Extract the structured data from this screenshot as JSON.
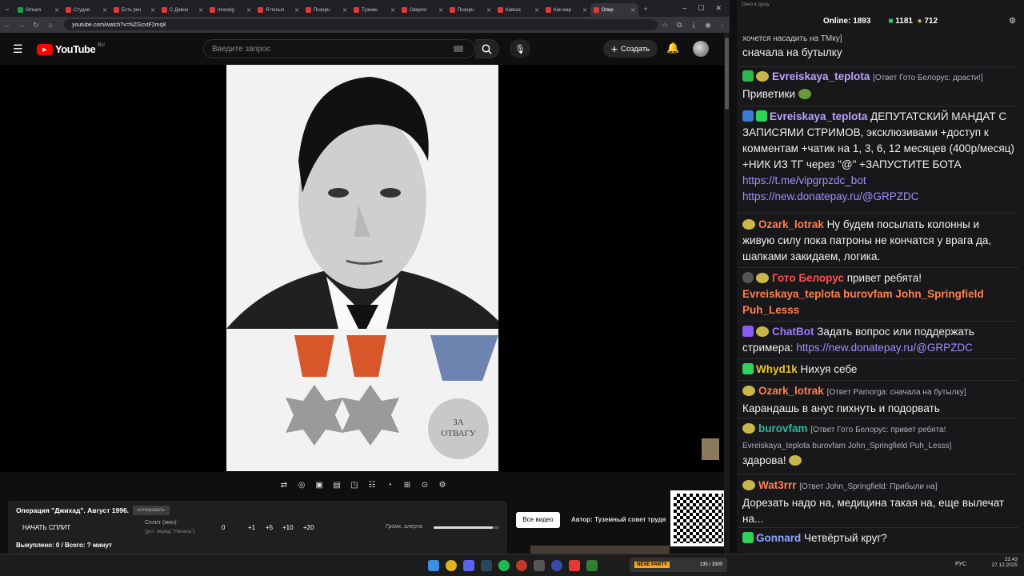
{
  "tabs": [
    {
      "label": "Stream",
      "color": "#1aa14a",
      "active": false
    },
    {
      "label": "Студия",
      "color": "#e53935",
      "active": false
    },
    {
      "label": "Есть реч",
      "color": "#e53935",
      "active": false
    },
    {
      "label": "С Девон",
      "color": "#e53935",
      "active": false
    },
    {
      "label": "Investig",
      "color": "#e53935",
      "active": false
    },
    {
      "label": "Я посыл",
      "color": "#e53935",
      "active": false
    },
    {
      "label": "Позорн",
      "color": "#e53935",
      "active": false
    },
    {
      "label": "Туземн",
      "color": "#e53935",
      "active": false
    },
    {
      "label": "Оверло",
      "color": "#e53935",
      "active": false
    },
    {
      "label": "Позорн",
      "color": "#e53935",
      "active": false
    },
    {
      "label": "Кавказ",
      "color": "#e53935",
      "active": false
    },
    {
      "label": "Как мар",
      "color": "#e53935",
      "active": false
    },
    {
      "label": "Опер",
      "color": "#e53935",
      "active": true
    }
  ],
  "browser": {
    "url": "youtube.com/watch?v=NZGcvtF2mq8"
  },
  "youtube": {
    "logo": "YouTube",
    "region": "RU",
    "search_placeholder": "Введите запрос",
    "create_label": "Создать"
  },
  "panel": {
    "title": "Операция \"Джихад\". Август 1996.",
    "copy_label": "копировать",
    "start_split": "НАЧАТЬ СПЛИТ",
    "split_label": "Сплит (мин):",
    "split_hint": "(уст. перед \"Начать\")",
    "split_value": "0",
    "steps": [
      "+1",
      "+5",
      "+10",
      "+20"
    ],
    "volume_label": "Громк. алерта:",
    "volume_level": 0.9,
    "paid": "Выкуплено: 0 / Всего: ? минут"
  },
  "overlay": {
    "all_video": "Все видео",
    "author": "Автор: Туземный совет трудя"
  },
  "chat_window_title": "Окно в душу",
  "chat_header": {
    "online_label": "Online:",
    "online": "1893",
    "count1": "1181",
    "count2": "712"
  },
  "chat": [
    {
      "name": "",
      "reply": "",
      "text": "хочется насадить на ТМку]",
      "text2": "сначала на бутылку",
      "color": "#fff"
    },
    {
      "name": "Evreiskaya_teplota",
      "reply": "[Ответ Гото Белорус: драсти!]",
      "text": "Приветики",
      "color": "#b9a3ff"
    },
    {
      "name": "Evreiskaya_teplota",
      "reply": "",
      "text": "ДЕПУТАТСКИЙ МАНДАТ С ЗАПИСЯМИ СТРИМОВ, эксклюзивами +доступ к комментам +чатик на 1, 3, 6, 12 месяцев (400р/месяц) +НИК ИЗ ТГ через \"@\" +ЗАПУСТИТЕ БОТА",
      "link1": "https://t.me/vipgrpzdc_bot",
      "link2": "https://new.donatepay.ru/@GRPZDC",
      "color": "#b9a3ff"
    },
    {
      "name": "Ozark_lotrak",
      "reply": "",
      "text": "Ну будем посылать колонны и живую силу пока патроны не кончатся у врага да, шапками закидаем, логика.",
      "color": "#ff7f50"
    },
    {
      "name": "Гото Белорус",
      "reply": "",
      "text": "привет ребята!",
      "mentions": "Evreiskaya_teplota burovfam John_Springfield Puh_Lesss",
      "color": "#ff4f4f"
    },
    {
      "name": "ChatBot",
      "reply": "",
      "text": "Задать вопрос или поддержать стримера:",
      "link1": "https://new.donatepay.ru/@GRPZDC",
      "color": "#9b7bff"
    },
    {
      "name": "Whyd1k",
      "reply": "",
      "text": "Нихуя себе",
      "color": "#e6c229"
    },
    {
      "name": "Ozark_lotrak",
      "reply": "[Ответ Pamorga: сначала на бутылку]",
      "text": "Карандашь в анус пихнуть и подорвать",
      "color": "#ff7f50"
    },
    {
      "name": "burovfam",
      "reply": "[Ответ Гото Белорус: привет ребята! Evreiskaya_teplota burovfam John_Springfield Puh_Lesss]",
      "text": "здарова!",
      "color": "#2fb89a"
    },
    {
      "name": "Wat3rrr",
      "reply": "[Ответ John_Springfield: Прибыли на]",
      "text": "Дорезать надо на, медицина такая на, еще вылечат на...",
      "color": "#ff7f50"
    },
    {
      "name": "Gonnard",
      "reply": "",
      "text": "Четвёртый круг?",
      "color": "#8fa6ff"
    }
  ],
  "taskbar": {
    "lang": "РУС",
    "time": "22:43",
    "date": "27.12.2025",
    "stream_banner": "NEXE PARTY",
    "stream_stat": "135 / 1500"
  }
}
